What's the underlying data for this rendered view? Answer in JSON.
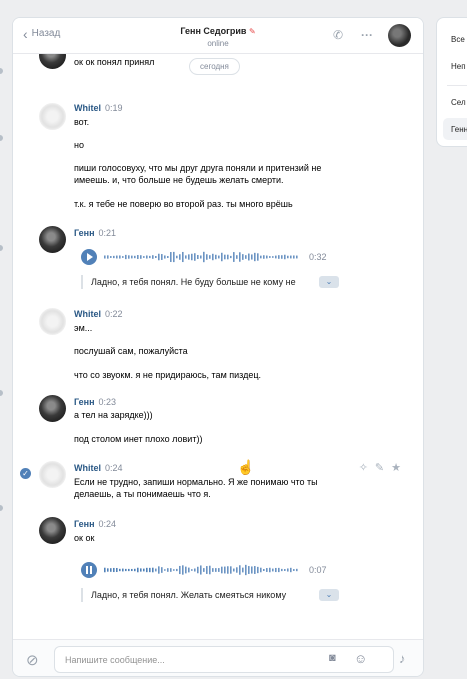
{
  "header": {
    "back_label": "Назад",
    "name": "Генн Седогрив",
    "status": "online"
  },
  "date_pill": "сегодня",
  "messages": [
    {
      "text": "ок ок понял принял"
    },
    {
      "author": "Whitel",
      "time": "0:19",
      "lines": [
        "вот.",
        "но",
        "пиши голосовуху, что мы друг друга поняли и притензий не имеешь. и, что больше не будешь желать смерти.",
        "т.к. я тебе не поверю во второй раз. ты много врёшь"
      ]
    },
    {
      "author": "Генн",
      "time": "0:21",
      "voice": {
        "duration": "0:32",
        "progress": 0,
        "transcript": "Ладно, я тебя понял. Не буду больше не кому не"
      }
    },
    {
      "author": "Whitel",
      "time": "0:22",
      "lines": [
        "эм...",
        "послушай сам, пожалуйста",
        "что со звуокм. я не придираюсь, там пиздец."
      ]
    },
    {
      "author": "Генн",
      "time": "0:23",
      "lines": [
        "а тел на зарядке)))",
        "под столом инет плохо ловит))"
      ]
    },
    {
      "author": "Whitel",
      "time": "0:24",
      "lines": [
        "Если не трудно, запиши нормально. Я же понимаю что ты делаешь, а ты понимаешь что я."
      ]
    },
    {
      "author": "Генн",
      "time": "0:24",
      "lines": [
        "ок ок"
      ],
      "voice": {
        "duration": "0:07",
        "progress": 0.25,
        "transcript": "Ладно, я тебя понял. Желать смеяться никому"
      }
    }
  ],
  "composer": {
    "placeholder": "Напишите сообщение..."
  },
  "right_panel": {
    "items": [
      "Все",
      "Неп",
      "Сел",
      "Генн"
    ]
  },
  "colors": {
    "accent": "#5181b8",
    "author": "#2a5885",
    "muted": "#828a99",
    "background": "#edeef0"
  },
  "icons": [
    "chevron-left-icon",
    "phone-icon",
    "more-icon",
    "check-icon",
    "sparkle-icon",
    "pencil-icon",
    "star-icon",
    "paperclip-icon",
    "camera-icon",
    "smile-icon",
    "microphone-icon",
    "hand-cursor-icon",
    "play-icon",
    "pause-icon"
  ]
}
